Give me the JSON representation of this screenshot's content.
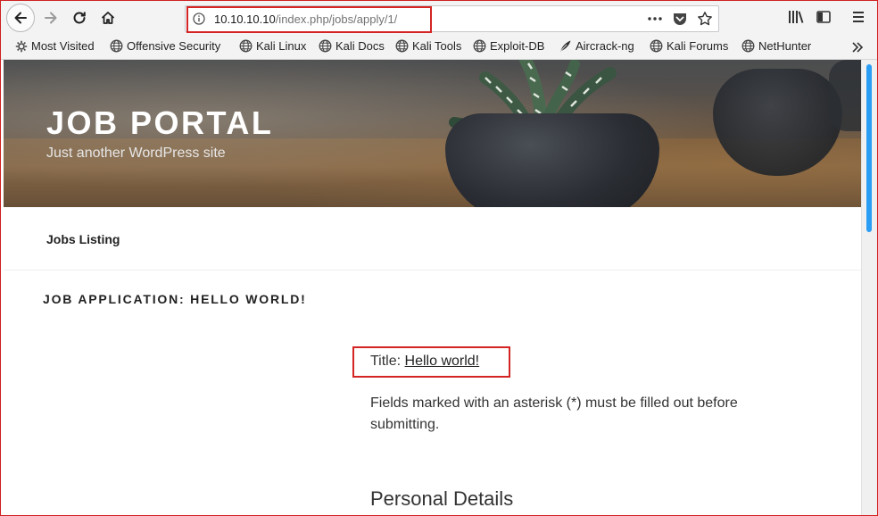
{
  "browser": {
    "url_host": "10.10.10.10",
    "url_path": "/index.php/jobs/apply/1/",
    "menu_icon": "hamburger-icon"
  },
  "bookmarks": [
    {
      "label": "Most Visited",
      "icon": "gear-icon"
    },
    {
      "label": "Offensive Security",
      "icon": "globe-icon"
    },
    {
      "label": "Kali Linux",
      "icon": "globe-icon"
    },
    {
      "label": "Kali Docs",
      "icon": "globe-icon"
    },
    {
      "label": "Kali Tools",
      "icon": "globe-icon"
    },
    {
      "label": "Exploit-DB",
      "icon": "globe-icon"
    },
    {
      "label": "Aircrack-ng",
      "icon": "feather-icon"
    },
    {
      "label": "Kali Forums",
      "icon": "globe-icon"
    },
    {
      "label": "NetHunter",
      "icon": "globe-icon"
    }
  ],
  "site": {
    "title": "JOB PORTAL",
    "description": "Just another WordPress site"
  },
  "nav": {
    "jobs_listing": "Jobs Listing"
  },
  "content": {
    "entry_title": "JOB APPLICATION: HELLO WORLD!",
    "title_label": "Title:",
    "title_link": "Hello world!",
    "fields_note": "Fields marked with an asterisk (*) must be filled out before submitting.",
    "section_heading": "Personal Details"
  },
  "colors": {
    "highlight": "#d42424",
    "scroll_thumb": "#2a9df4"
  }
}
